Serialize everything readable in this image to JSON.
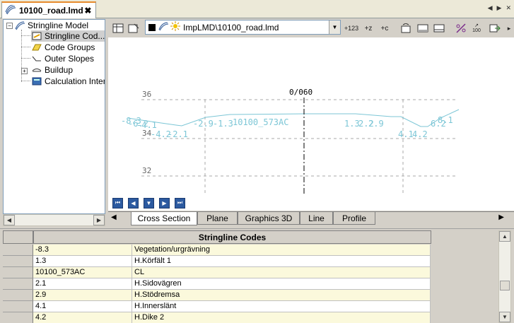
{
  "document_tab": {
    "title": "10100_road.lmd",
    "close": "✖"
  },
  "tree": {
    "root": "Stringline Model",
    "items": [
      {
        "label": "Stringline Cod..."
      },
      {
        "label": "Code Groups"
      },
      {
        "label": "Outer Slopes"
      },
      {
        "label": "Buildup"
      },
      {
        "label": "Calculation Inter."
      }
    ]
  },
  "toolbar": {
    "model_select": "ImpLMD\\10100_road.lmd",
    "label_123": "+123",
    "label_z": "+z",
    "label_c": "+c",
    "label_100": "100"
  },
  "cross_section": {
    "station": "0/060",
    "y_labels": [
      "36",
      "34",
      "32"
    ],
    "point_labels": [
      "-8.3",
      "-6.2",
      "-4.1",
      "-4.2",
      "-2.1",
      "-2.9",
      "-1.3",
      "10100_573AC",
      "1.3",
      "2.2",
      "2.9",
      "4.1",
      "4.2",
      "6.2",
      "8.1"
    ],
    "line_color": "#7cc6d6"
  },
  "view_tabs": [
    "Cross Section",
    "Plane",
    "Graphics 3D",
    "Line",
    "Profile"
  ],
  "grid": {
    "header": "Stringline Codes",
    "rows": [
      {
        "code": "-8.3",
        "name": "Vegetation/urgrävning"
      },
      {
        "code": "1.3",
        "name": "H.Körfält 1"
      },
      {
        "code": "10100_573AC",
        "name": "CL"
      },
      {
        "code": "2.1",
        "name": "H.Sidovägren"
      },
      {
        "code": "2.9",
        "name": "H.Stödremsa"
      },
      {
        "code": "4.1",
        "name": "H.Innerslänt"
      },
      {
        "code": "4.2",
        "name": "H.Dike 2"
      }
    ]
  }
}
